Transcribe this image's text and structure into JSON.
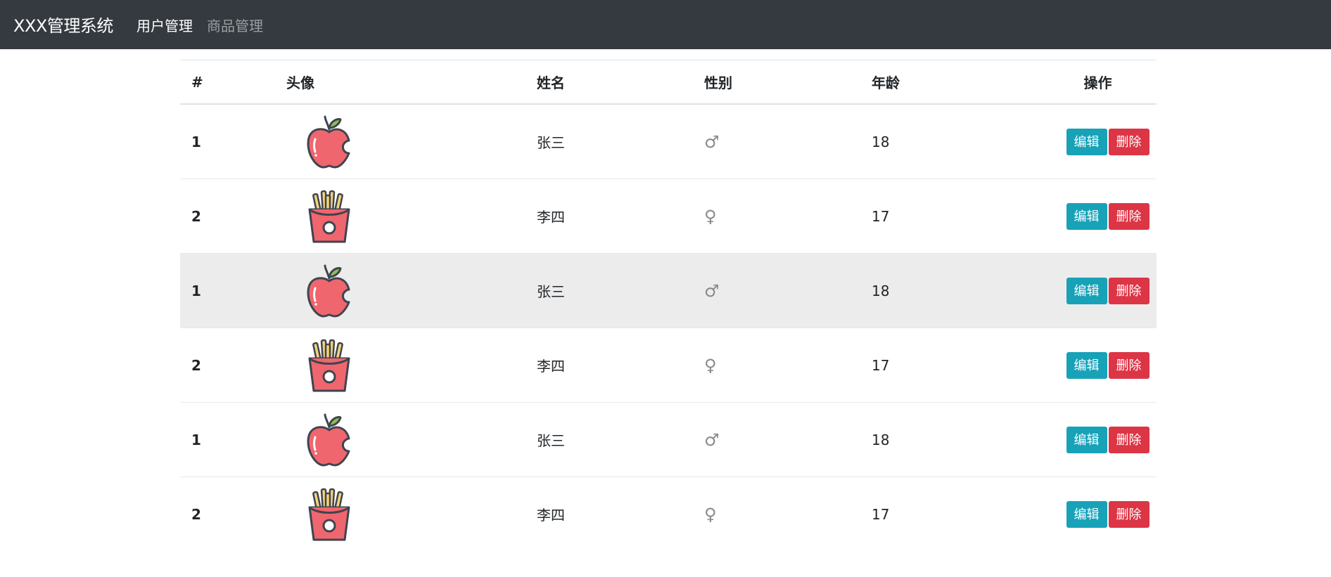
{
  "navbar": {
    "brand": "XXX管理系统",
    "links": [
      {
        "label": "用户管理",
        "active": true
      },
      {
        "label": "商品管理",
        "active": false
      }
    ]
  },
  "table": {
    "headers": [
      "#",
      "头像",
      "姓名",
      "性别",
      "年龄",
      "操作"
    ],
    "rows": [
      {
        "index": "1",
        "avatar": "apple-icon",
        "name": "张三",
        "gender": "♂",
        "age": "18",
        "edit": "编辑",
        "delete": "删除",
        "highlight": false
      },
      {
        "index": "2",
        "avatar": "fries-icon",
        "name": "李四",
        "gender": "♀",
        "age": "17",
        "edit": "编辑",
        "delete": "删除",
        "highlight": false
      },
      {
        "index": "1",
        "avatar": "apple-icon",
        "name": "张三",
        "gender": "♂",
        "age": "18",
        "edit": "编辑",
        "delete": "删除",
        "highlight": true
      },
      {
        "index": "2",
        "avatar": "fries-icon",
        "name": "李四",
        "gender": "♀",
        "age": "17",
        "edit": "编辑",
        "delete": "删除",
        "highlight": false
      },
      {
        "index": "1",
        "avatar": "apple-icon",
        "name": "张三",
        "gender": "♂",
        "age": "18",
        "edit": "编辑",
        "delete": "删除",
        "highlight": false
      },
      {
        "index": "2",
        "avatar": "fries-icon",
        "name": "李四",
        "gender": "♀",
        "age": "17",
        "edit": "编辑",
        "delete": "删除",
        "highlight": false
      }
    ]
  },
  "colors": {
    "navbar_bg": "#343a40",
    "edit_button": "#17a2b8",
    "delete_button": "#dc3545",
    "highlight_row": "#ececec"
  }
}
